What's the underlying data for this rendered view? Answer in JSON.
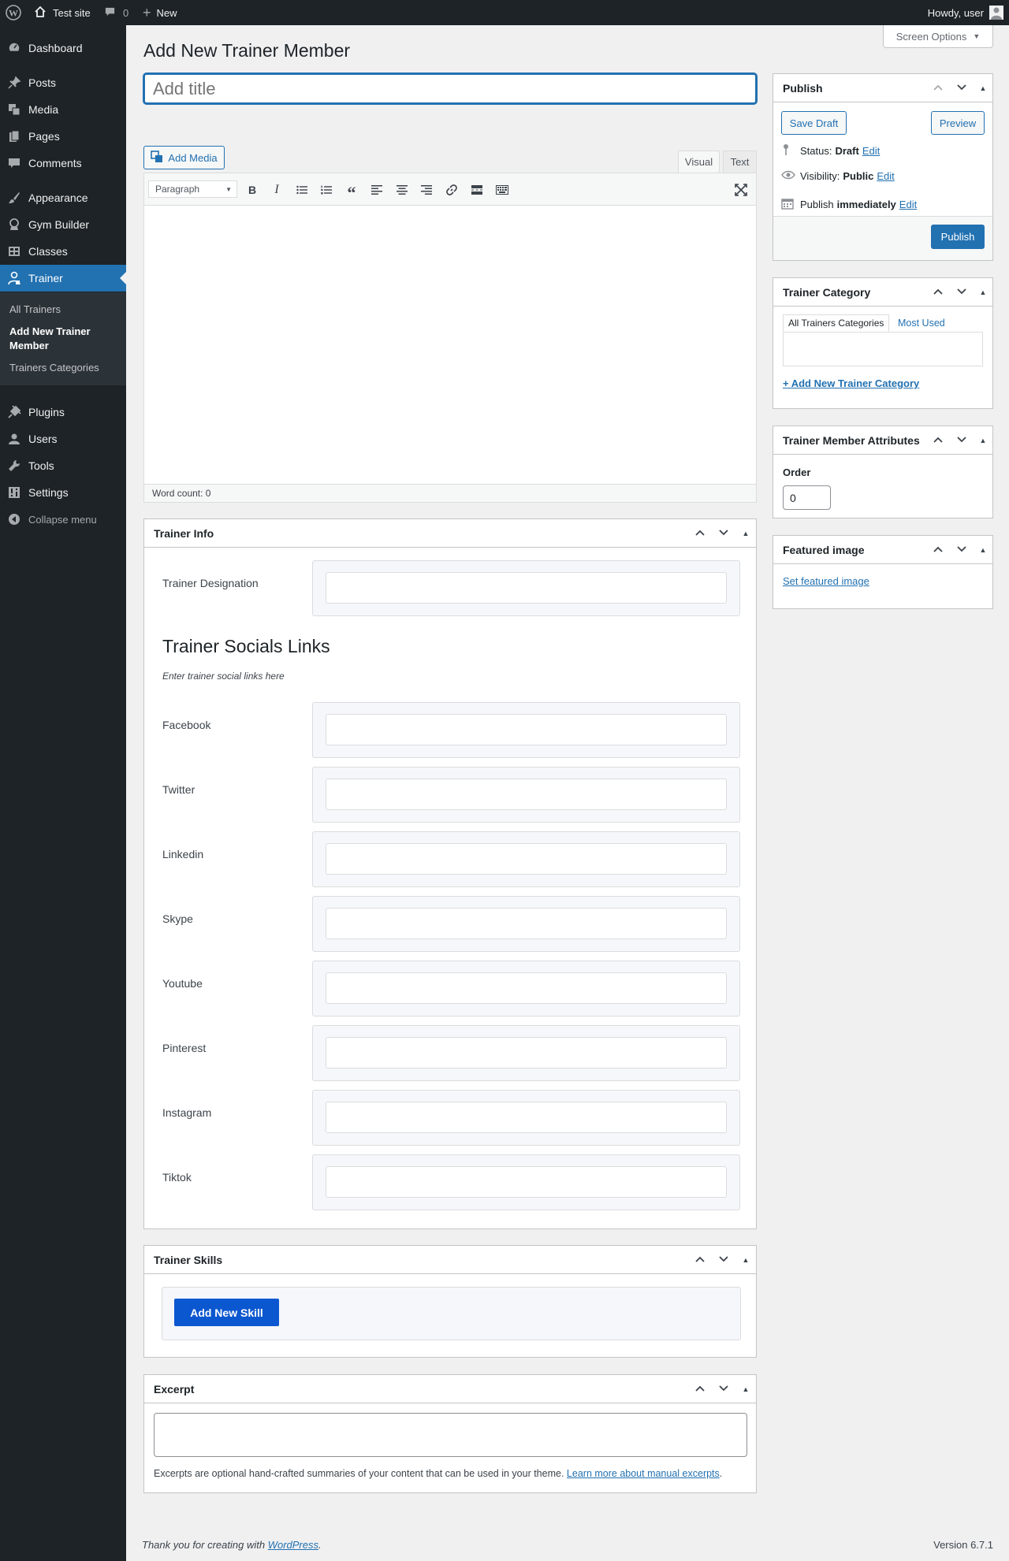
{
  "adminbar": {
    "site_name": "Test site",
    "comments_count": "0",
    "new_label": "New",
    "howdy": "Howdy, user"
  },
  "sidebar": {
    "items": [
      {
        "label": "Dashboard",
        "icon": "dashboard-icon"
      },
      {
        "label": "Posts",
        "icon": "pin-icon"
      },
      {
        "label": "Media",
        "icon": "media-icon"
      },
      {
        "label": "Pages",
        "icon": "pages-icon"
      },
      {
        "label": "Comments",
        "icon": "comment-icon"
      },
      {
        "label": "Appearance",
        "icon": "brush-icon"
      },
      {
        "label": "Gym Builder",
        "icon": "gym-icon"
      },
      {
        "label": "Classes",
        "icon": "classes-icon"
      },
      {
        "label": "Trainer",
        "icon": "trainer-icon"
      },
      {
        "label": "Plugins",
        "icon": "plugin-icon"
      },
      {
        "label": "Users",
        "icon": "user-icon"
      },
      {
        "label": "Tools",
        "icon": "wrench-icon"
      },
      {
        "label": "Settings",
        "icon": "settings-icon"
      },
      {
        "label": "Collapse menu",
        "icon": "collapse-icon"
      }
    ],
    "submenu": [
      "All Trainers",
      "Add New Trainer Member",
      "Trainers Categories"
    ]
  },
  "header": {
    "page_title": "Add New Trainer Member",
    "screen_options": "Screen Options",
    "title_placeholder": "Add title"
  },
  "editor": {
    "add_media": "Add Media",
    "tab_visual": "Visual",
    "tab_text": "Text",
    "format_select": "Paragraph",
    "word_count": "Word count: 0"
  },
  "trainer_info": {
    "title": "Trainer Info",
    "designation_label": "Trainer Designation",
    "socials_heading": "Trainer Socials Links",
    "socials_desc": "Enter trainer social links here",
    "socials": [
      "Facebook",
      "Twitter",
      "Linkedin",
      "Skype",
      "Youtube",
      "Pinterest",
      "Instagram",
      "Tiktok"
    ]
  },
  "skills": {
    "title": "Trainer Skills",
    "add_button": "Add New Skill"
  },
  "excerpt": {
    "title": "Excerpt",
    "help": "Excerpts are optional hand-crafted summaries of your content that can be used in your theme.",
    "link": "Learn more about manual excerpts",
    "period": "."
  },
  "publish": {
    "title": "Publish",
    "save_draft": "Save Draft",
    "preview": "Preview",
    "status_label": "Status:",
    "status_value": "Draft",
    "visibility_label": "Visibility:",
    "visibility_value": "Public",
    "publish_label": "Publish",
    "publish_value": "immediately",
    "edit": "Edit",
    "publish_button": "Publish"
  },
  "category": {
    "title": "Trainer Category",
    "tab_all": "All Trainers Categories",
    "tab_most_used": "Most Used",
    "add_new": "+ Add New Trainer Category"
  },
  "attributes": {
    "title": "Trainer Member Attributes",
    "order_label": "Order",
    "order_value": "0"
  },
  "featured": {
    "title": "Featured image",
    "set_link": "Set featured image"
  },
  "footer": {
    "thanks": "Thank you for creating with",
    "wp_link": "WordPress",
    "period": ".",
    "version": "Version 6.7.1"
  },
  "colors": {
    "accent": "#2271b1",
    "adminbar": "#1d2327",
    "skill_button": "#0b57d0"
  }
}
